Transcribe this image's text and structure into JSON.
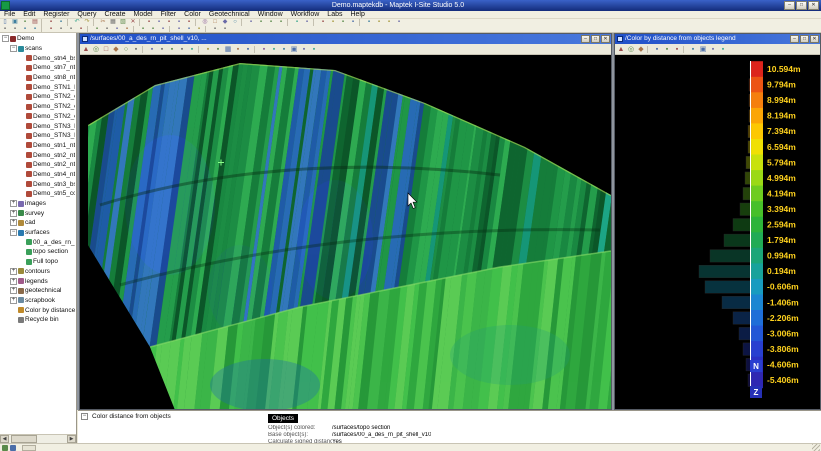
{
  "titlebar": {
    "title": "Demo.maptekdb - Maptek I-Site Studio 5.0",
    "buttons": [
      "minimize",
      "maximize",
      "close"
    ]
  },
  "menubar": {
    "items": [
      "File",
      "Edit",
      "Register",
      "Query",
      "Create",
      "Model",
      "Filter",
      "Color",
      "Geotechnical",
      "Window",
      "Workflow",
      "Labs",
      "Help"
    ]
  },
  "toolbars": {
    "row1": [
      "new",
      "open",
      "save",
      "print",
      "|",
      "import",
      "export",
      "|",
      "undo",
      "redo",
      "|",
      "cut",
      "copy",
      "paste",
      "delete",
      "|",
      "select-rect",
      "select-poly",
      "select-lasso",
      "deselect",
      "invert-selection",
      "|",
      "zoom-extents",
      "zoom-window",
      "pan",
      "orbit",
      "|",
      "view-top",
      "view-front",
      "view-east",
      "view-iso",
      "|",
      "measure-distance",
      "query-point",
      "|",
      "filter-polygon",
      "filter-topography",
      "filter-vegetation",
      "filter-isolated",
      "|",
      "triangulate",
      "decimate",
      "smooth-surface",
      "contour-tool"
    ],
    "row2": [
      "register-scan",
      "register-global",
      "georeference",
      "station-setup",
      "|",
      "color-by-height",
      "color-by-distance",
      "color-by-intensity",
      "color-ramp-edit",
      "|",
      "create-point",
      "create-line",
      "create-polygon",
      "create-text",
      "|",
      "model-surface",
      "model-solid",
      "boolean-ops",
      "|",
      "workflow-editor",
      "report-generator",
      "scrapbook-add",
      "|",
      "settings",
      "help-about"
    ]
  },
  "explorer": {
    "nodes": [
      {
        "label": "Demo",
        "depth": 0,
        "icon": "database",
        "expand": "minus"
      },
      {
        "label": "scans",
        "depth": 1,
        "icon": "folder-scans",
        "expand": "minus"
      },
      {
        "label": "Demo_stn4_bs1...",
        "depth": 2,
        "icon": "scan"
      },
      {
        "label": "Demo_stn7_ntho...",
        "depth": 2,
        "icon": "scan"
      },
      {
        "label": "Demo_stn8_ntho...",
        "depth": 2,
        "icon": "scan"
      },
      {
        "label": "Demo_STN1_RN...",
        "depth": 2,
        "icon": "scan"
      },
      {
        "label": "Demo_STN2_co...",
        "depth": 2,
        "icon": "scan"
      },
      {
        "label": "Demo_STN2_co...",
        "depth": 2,
        "icon": "scan"
      },
      {
        "label": "Demo_STN2_co...",
        "depth": 2,
        "icon": "scan"
      },
      {
        "label": "Demo_STN3_RN...",
        "depth": 2,
        "icon": "scan"
      },
      {
        "label": "Demo_STN3_RN...",
        "depth": 2,
        "icon": "scan"
      },
      {
        "label": "Demo_stn1_ntho...",
        "depth": 2,
        "icon": "scan"
      },
      {
        "label": "Demo_stn2_ntho...",
        "depth": 2,
        "icon": "scan"
      },
      {
        "label": "Demo_stn2_ntho...",
        "depth": 2,
        "icon": "scan"
      },
      {
        "label": "Demo_stn4_ntho...",
        "depth": 2,
        "icon": "scan"
      },
      {
        "label": "Demo_stn3_bs1...",
        "depth": 2,
        "icon": "scan"
      },
      {
        "label": "Demo_stn5_co...",
        "depth": 2,
        "icon": "scan"
      },
      {
        "label": "images",
        "depth": 1,
        "icon": "folder-images",
        "expand": "plus"
      },
      {
        "label": "survey",
        "depth": 1,
        "icon": "folder-survey",
        "expand": "plus"
      },
      {
        "label": "cad",
        "depth": 1,
        "icon": "folder-cad",
        "expand": "plus"
      },
      {
        "label": "surfaces",
        "depth": 1,
        "icon": "folder-surfaces",
        "expand": "minus"
      },
      {
        "label": "00_a_des_rn_pit...",
        "depth": 2,
        "icon": "surface"
      },
      {
        "label": "topo section",
        "depth": 2,
        "icon": "surface"
      },
      {
        "label": "Full topo",
        "depth": 2,
        "icon": "surface"
      },
      {
        "label": "contours",
        "depth": 1,
        "icon": "folder-contours",
        "expand": "plus"
      },
      {
        "label": "legends",
        "depth": 1,
        "icon": "folder-legends",
        "expand": "plus"
      },
      {
        "label": "geotechnical",
        "depth": 1,
        "icon": "folder-geotech",
        "expand": "plus"
      },
      {
        "label": "scrapbook",
        "depth": 1,
        "icon": "folder-scrapbook",
        "expand": "plus"
      },
      {
        "label": "Color by distance f...",
        "depth": 1,
        "icon": "legend-item"
      },
      {
        "label": "Recycle bin",
        "depth": 1,
        "icon": "recycle-bin"
      }
    ]
  },
  "viewport": {
    "title": "/surfaces/00_a_des_rn_pit_shell_v10, ...",
    "buttons": [
      "minimize",
      "maximize",
      "close"
    ],
    "toolbar": [
      "view-home",
      "zoom-all",
      "zoom-box",
      "pan-tool",
      "orbit-tool",
      "look-around",
      "|",
      "view-plan",
      "view-north",
      "view-east",
      "view-west",
      "view-perspective",
      "|",
      "shade-smooth",
      "shade-flat",
      "wireframe",
      "show-edges",
      "lighting",
      "|",
      "clip-screen",
      "section-create",
      "annotate",
      "snapshot",
      "print-view",
      "render-settings"
    ]
  },
  "legend": {
    "title": "/Color by distance from objects legend",
    "buttons": [
      "minimize",
      "maximize",
      "close"
    ],
    "toolbar": [
      "view-home",
      "zoom-all",
      "pan-tool",
      "|",
      "legend-edit",
      "legend-settings",
      "color-ramp-edit",
      "|",
      "annotate",
      "snapshot",
      "print-view",
      "render-settings"
    ],
    "entries": [
      {
        "label": "10.594m",
        "color": "#dc241c",
        "hist": 0.02
      },
      {
        "label": "9.794m",
        "color": "#ec5414",
        "hist": 0.03
      },
      {
        "label": "8.994m",
        "color": "#f57f0e",
        "hist": 0.03
      },
      {
        "label": "8.194m",
        "color": "#fba506",
        "hist": 0.04
      },
      {
        "label": "7.394m",
        "color": "#fdc802",
        "hist": 0.05
      },
      {
        "label": "6.594m",
        "color": "#f0e003",
        "hist": 0.06
      },
      {
        "label": "5.794m",
        "color": "#c8e20c",
        "hist": 0.09
      },
      {
        "label": "4.994m",
        "color": "#9bd916",
        "hist": 0.12
      },
      {
        "label": "4.194m",
        "color": "#6ecc20",
        "hist": 0.16
      },
      {
        "label": "3.394m",
        "color": "#47c02a",
        "hist": 0.22
      },
      {
        "label": "2.594m",
        "color": "#2db43a",
        "hist": 0.34
      },
      {
        "label": "1.794m",
        "color": "#21ab55",
        "hist": 0.52
      },
      {
        "label": "0.994m",
        "color": "#1ca678",
        "hist": 0.78
      },
      {
        "label": "0.194m",
        "color": "#18a29b",
        "hist": 1.0
      },
      {
        "label": "-0.606m",
        "color": "#189bc0",
        "hist": 0.88
      },
      {
        "label": "-1.406m",
        "color": "#1b86d2",
        "hist": 0.55
      },
      {
        "label": "-2.206m",
        "color": "#1f6ed8",
        "hist": 0.34
      },
      {
        "label": "-3.006m",
        "color": "#2357d6",
        "hist": 0.24
      },
      {
        "label": "-3.806m",
        "color": "#283fd0",
        "hist": 0.16
      },
      {
        "label": "-4.606m",
        "color": "#2b30c4",
        "hist": 0.1
      },
      {
        "label": "-5.406m",
        "color": "#2f27b2",
        "hist": 0.05
      }
    ],
    "axis_markers": [
      {
        "label": "N",
        "color": "#2a3fd0"
      },
      {
        "label": "Z",
        "color": "#2630b6"
      }
    ]
  },
  "properties": {
    "title": "Color distance from objects",
    "tab": "Objects",
    "rows": [
      {
        "label": "Object(s) colored:",
        "value": "/surfaces/topo section"
      },
      {
        "label": "Base object(s):",
        "value": "/surfaces/00_a_des_rn_pit_shell_v10"
      },
      {
        "label": "Calculate signed distances:",
        "value": "Yes"
      }
    ]
  },
  "statusbar": {
    "icons": [
      "layers",
      "snap-mode"
    ]
  }
}
